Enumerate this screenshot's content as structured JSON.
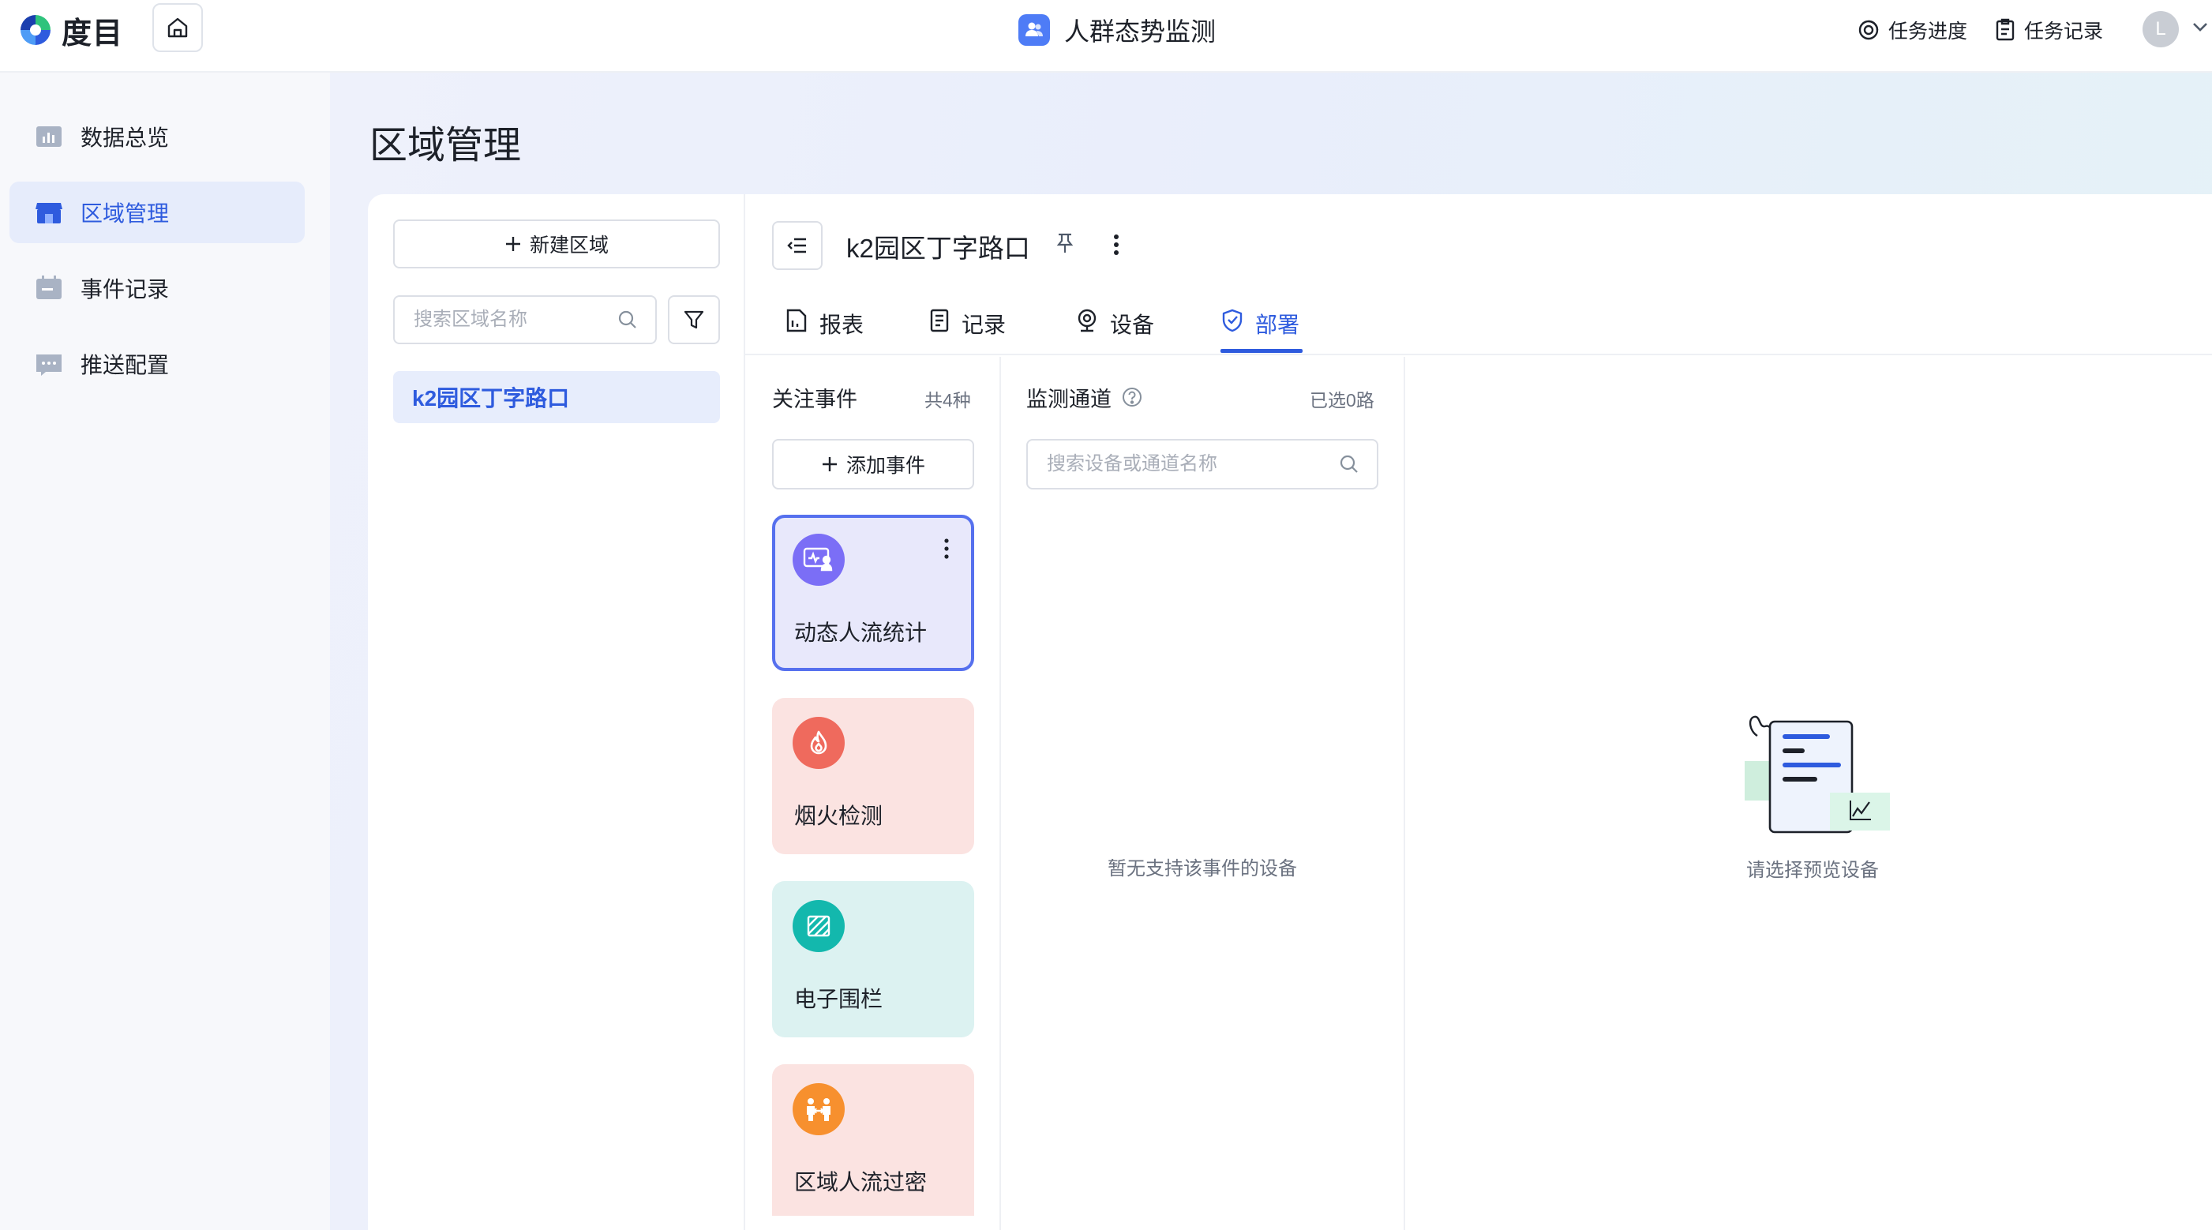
{
  "brand": {
    "name": "度目"
  },
  "header": {
    "app_title": "人群态势监测",
    "actions": [
      {
        "label": "任务进度",
        "icon": "progress-ring-icon"
      },
      {
        "label": "任务记录",
        "icon": "clipboard-icon"
      }
    ],
    "avatar_initial": "L"
  },
  "sidebar": {
    "items": [
      {
        "label": "数据总览",
        "icon": "bar-chart-icon",
        "active": false
      },
      {
        "label": "区域管理",
        "icon": "store-icon",
        "active": true
      },
      {
        "label": "事件记录",
        "icon": "calendar-icon",
        "active": false
      },
      {
        "label": "推送配置",
        "icon": "message-icon",
        "active": false
      }
    ]
  },
  "page": {
    "title": "区域管理"
  },
  "region_panel": {
    "new_button": "新建区域",
    "search_placeholder": "搜索区域名称",
    "regions": [
      {
        "name": "k2园区丁字路口",
        "selected": true
      }
    ]
  },
  "detail": {
    "title": "k2园区丁字路口",
    "tabs": [
      {
        "label": "报表",
        "icon": "report-icon",
        "active": false
      },
      {
        "label": "记录",
        "icon": "record-icon",
        "active": false
      },
      {
        "label": "设备",
        "icon": "camera-icon",
        "active": false
      },
      {
        "label": "部署",
        "icon": "shield-check-icon",
        "active": true
      }
    ]
  },
  "events": {
    "title": "关注事件",
    "count": "共4种",
    "add_button": "添加事件",
    "items": [
      {
        "name": "动态人流统计",
        "color": "#7b6ef6",
        "bg": "#e8e8fb",
        "selected": true
      },
      {
        "name": "烟火检测",
        "color": "#ef6a5d",
        "bg": "#fbe3e1",
        "selected": false
      },
      {
        "name": "电子围栏",
        "color": "#13b8ad",
        "bg": "#dcf2f1",
        "selected": false
      },
      {
        "name": "区域人流过密",
        "color": "#f7902e",
        "bg": "#fbe3e1",
        "selected": false
      }
    ]
  },
  "channels": {
    "title": "监测通道",
    "selected_count": "已选0路",
    "search_placeholder": "搜索设备或通道名称",
    "empty_text": "暂无支持该事件的设备"
  },
  "preview": {
    "empty_text": "请选择预览设备"
  },
  "colors": {
    "primary": "#2e5bde",
    "border": "#dcdfe6"
  }
}
